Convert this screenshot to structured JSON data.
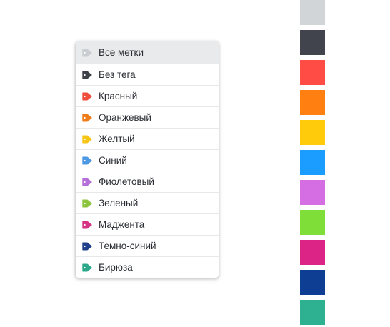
{
  "tag_menu": {
    "selected_index": 0,
    "items": [
      {
        "label": "Все метки",
        "color": "#c9cdd1",
        "icon": "tag-icon"
      },
      {
        "label": "Без тега",
        "color": "#3f4149",
        "icon": "tag-icon"
      },
      {
        "label": "Красный",
        "color": "#ef4e3d",
        "icon": "tag-icon"
      },
      {
        "label": "Оранжевый",
        "color": "#f07d1a",
        "icon": "tag-icon"
      },
      {
        "label": "Желтый",
        "color": "#f5c518",
        "icon": "tag-icon"
      },
      {
        "label": "Синий",
        "color": "#4c98e3",
        "icon": "tag-icon"
      },
      {
        "label": "Фиолетовый",
        "color": "#b66fd8",
        "icon": "tag-icon"
      },
      {
        "label": "Зеленый",
        "color": "#8cc63e",
        "icon": "tag-icon"
      },
      {
        "label": "Маджента",
        "color": "#d63384",
        "icon": "tag-icon"
      },
      {
        "label": "Темно-синий",
        "color": "#1f3f8a",
        "icon": "tag-icon"
      },
      {
        "label": "Бирюза",
        "color": "#2aa889",
        "icon": "tag-icon"
      }
    ]
  },
  "color_swatches": [
    {
      "name": "gray",
      "color": "#d1d5d8"
    },
    {
      "name": "dark",
      "color": "#42444d"
    },
    {
      "name": "red",
      "color": "#ff4c45"
    },
    {
      "name": "orange",
      "color": "#ff7f10"
    },
    {
      "name": "yellow",
      "color": "#ffcb0a"
    },
    {
      "name": "blue",
      "color": "#1a9dff"
    },
    {
      "name": "violet",
      "color": "#d56ee3"
    },
    {
      "name": "green",
      "color": "#7fdf38"
    },
    {
      "name": "magenta",
      "color": "#db2485"
    },
    {
      "name": "dark-blue",
      "color": "#0d3e94"
    },
    {
      "name": "turquoise",
      "color": "#2db191"
    }
  ]
}
